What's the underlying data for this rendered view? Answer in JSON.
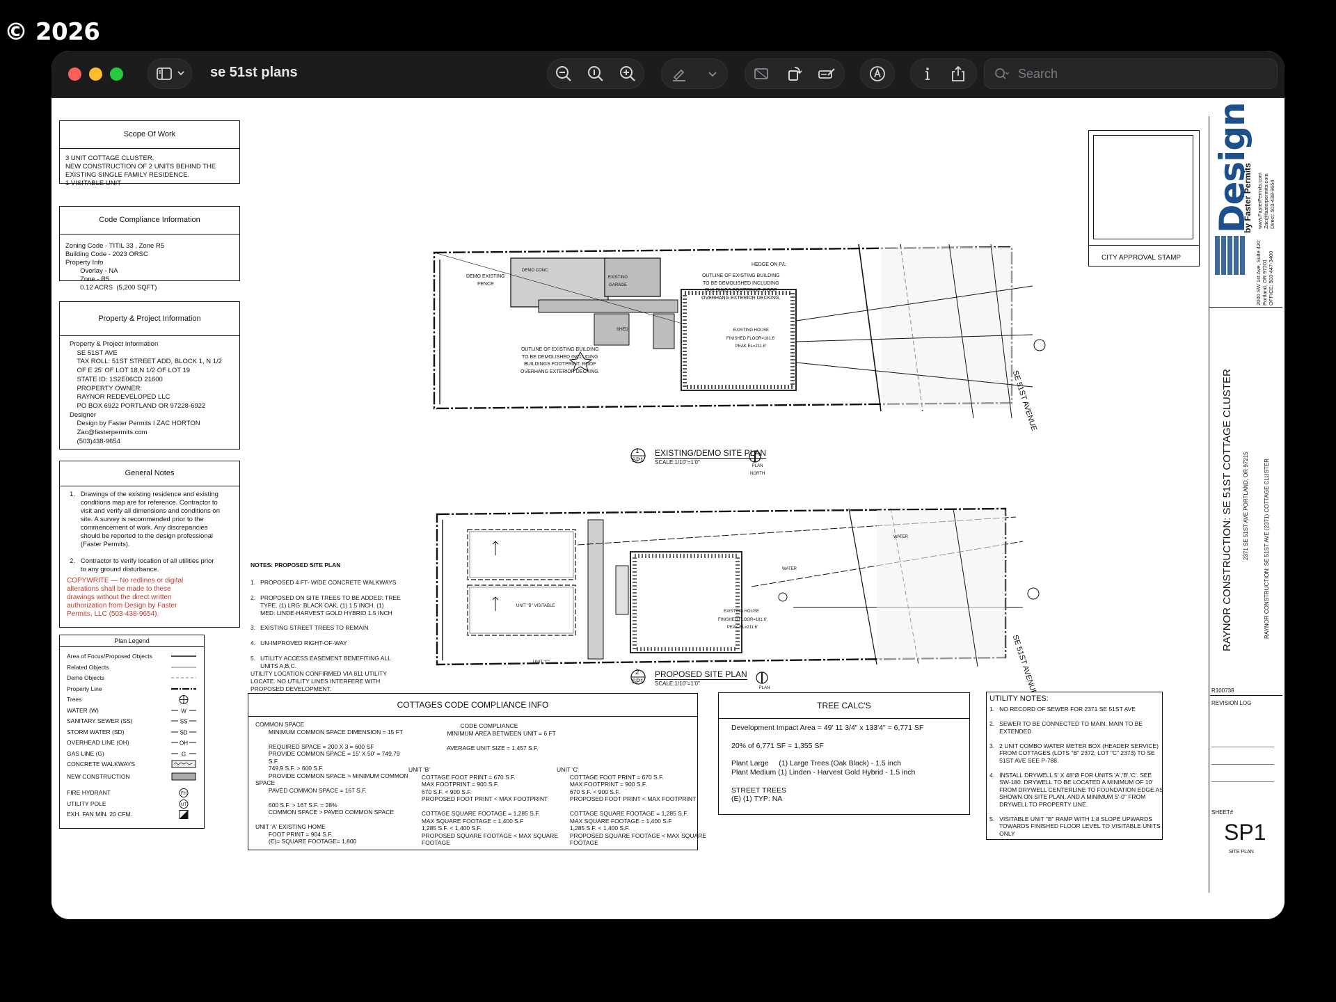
{
  "watermark": "© 2026",
  "window": {
    "title": "se 51st plans",
    "search_placeholder": "Search",
    "toolbar_icons": [
      "sidebar-icon",
      "chevron-down-icon",
      "zoom-out-icon",
      "actual-size-icon",
      "zoom-in-icon",
      "highlight-pen-icon",
      "chevron-down-icon",
      "crop-icon",
      "rotate-icon",
      "markup-sign-icon",
      "markup-circle-icon",
      "info-icon",
      "share-icon",
      "search-icon"
    ]
  },
  "sheet": {
    "scope": {
      "title": "Scope Of Work",
      "body": "3 UNIT COTTAGE CLUSTER.\nNEW CONSTRUCTION OF 2 UNITS BEHIND THE\nEXISTING SINGLE FAMILY RESIDENCE.\n1 VISITABLE UNIT"
    },
    "code": {
      "title": "Code Compliance Information",
      "body": "Zoning Code - TITIL 33 , Zone R5\nBuilding Code - 2023 ORSC\nProperty Info\n        Overlay - NA\n        Zone - R5\n        0.12 ACRS  (5,200 SQFT)"
    },
    "property": {
      "title": "Property & Project Information",
      "body": "Property & Project Information\n    SE 51ST AVE\n    TAX ROLL: 51ST STREET ADD, BLOCK 1, N 1/2\n    OF E 25' OF LOT 18,N 1/2 OF LOT 19\n    STATE ID: 1S2E06CD 21600\n    PROPERTY OWNER:\n    RAYNOR REDEVELOPED LLC\n    PO BOX 6922 PORTLAND OR 97228-6922\nDesigner\n    Design by Faster Permits I ZAC HORTON\n    Zac@fasterpermits.com\n    (503)438-9654"
    },
    "general": {
      "title": "General Notes",
      "body": "1.   Drawings of the existing residence and existing\n      conditions map are for reference. Contractor to\n      visit and verify all dimensions and conditions on\n      site. A survey is recommended prior to the\n      commencement of work. Any discrepancies\n      should be reported to the design professional\n      (Faster Permits).\n\n2.   Contractor to verify location of all utilities prior\n      to any ground disturbance.",
      "copyright": "COPYWRITE — No redlines or digital\nalterations shall be made to these\ndrawings without the direct written\nauthorization from Design by Faster\nPermits, LLC (503-438-9654)."
    },
    "legend": {
      "title": "Plan Legend",
      "items": [
        "Area of Focus/Proposed Objects",
        "Related Objects",
        "Demo Objects",
        "Property Line",
        "Trees",
        "WATER  (W)",
        "SANITARY SEWER (SS)",
        "STORM WATER (SD)",
        "OVERHEAD LINE (OH)",
        "GAS LINE (G)",
        "CONCRETE WALKWAYS",
        "NEW CONSTRUCTION",
        "FIRE HYDRANT",
        "UTILITY POLE",
        "EXH. FAN MIN. 20 CFM."
      ]
    },
    "notes_proposed": {
      "title": "NOTES: PROPOSED SITE PLAN",
      "body": "1.   PROPOSED 4 FT- WIDE CONCRETE WALKWAYS\n\n2.   PROPOSED ON SITE TREES TO BE ADDED: TREE\n      TYPE. (1) LRG: BLACK OAK, (1) 1.5 INCH. (1)\n      MED: LINDE-HARVEST GOLD HYBRID 1.5 INCH\n\n3.   EXISTING STREET TREES TO REMAIN\n\n4.   UN-IMPROVED RIGHT-OF-WAY\n\n5.   UTILITY ACCESS EASEMENT BENEFITING ALL\n      UNITS A,B,C.\nUTILITY LOCATION CONFIRMED VIA 811 UTILITY\nLOCATE. NO UTILITY LINES INTERFERE WITH\nPROPOSED DEVELOPMENT."
    },
    "plan1": {
      "num": "1",
      "sheet": "SP1",
      "title": "EXISTING/DEMO SITE PLAN",
      "scale": "SCALE:1/10\"=1'0\"",
      "north": "PLAN\nNORTH",
      "street": "SE 51ST AVENUE",
      "house": "EXISTING HOUSE",
      "floor": "FINISHED FLOOR=181.6'\nPEAK EL=211.6'",
      "demo_note1": "OUTLINE OF EXISTING BUILDING\nTO BE DEMOLISHED INCLUDING\nBUILDINGS FOOTPRINT, ROOF\nOVERHANG EXTERIOR DECKING.",
      "demo_note2": "OUTLINE OF EXISTING BUILDING\nTO BE DEMOLISHED INCLUDING\nBUILDINGS FOOTPRINT, ROOF\nOVERHANG EXTERIOR DECKING.",
      "fence": "DEMO EXISTING\nFENCE",
      "conc": "DEMO CONC.",
      "garage": "EXISTING\nGARAGE",
      "shed": "SHED",
      "hedge": "HEDGE ON P/L"
    },
    "plan2": {
      "num": "2",
      "sheet": "SP1",
      "title": "PROPOSED SITE PLAN",
      "scale": "SCALE:1/10\"=1'0\"",
      "north": "PLAN\nNORTH",
      "street": "SE 51ST AVENUE",
      "unitB": "UNIT \"B\" VISITABLE",
      "unitC": "UNIT \"C\"",
      "house": "EXISTING HOUSE",
      "floor": "FINISHED FLOOR=181.6'\nPEAK EL=211.6'",
      "water": "WATER"
    },
    "cottages": {
      "title": "COTTAGES CODE COMPLIANCE INFO",
      "col1": "COMMON SPACE\n        MINIMUM COMMON SPACE DIMENSION = 15 FT\n\n        REQUIRED SPACE = 200 X 3 = 600 SF\n        PROVIDE COMMON SPACE = 15' X 50' = 749.79\n        S.F.\n        749.9 S.F. > 600 S.F.\n        PROVIDE COMMON SPACE > MINIMUM COMMON\nSPACE\n        PAVED COMMON SPACE = 167 S.F.\n\n        600 S.F. > 167 S.F. = 28%\n        COMMON SPACE > PAVED COMMON SPACE\n\nUNIT 'A' EXISTING HOME\n        FOOT PRINT = 904 S.F.\n        (E)= SQUARE FOOTAGE= 1,800",
      "col2": "            CODE COMPLIANCE\n    MINIMUM AREA BETWEEN UNIT = 6 FT\n\n    AVERAGE UNIT SIZE = 1,457 S.F.",
      "unitB": "UNIT 'B'\n        COTTAGE FOOT PRINT = 670 S.F.\n        MAX FOOTPRINT = 900 S.F.\n        670 S.F. < 900 S.F.\n        PROPOSED FOOT PRINT < MAX FOOTPRINT\n\n        COTTAGE SQUARE FOOTAGE = 1,285 S.F.\n        MAX SQUARE FOOTAGE = 1,400 S.F\n        1,285 S.F. < 1,400 S.F.\n        PROPOSED SQUARE FOOTAGE < MAX SQUARE\n        FOOTAGE",
      "unitC": "UNIT 'C'\n        COTTAGE FOOT PRINT = 670 S.F.\n        MAX FOOTPRINT = 900 S.F.\n        670 S.F. < 900 S.F.\n        PROPOSED FOOT PRINT < MAX FOOTPRINT\n\n        COTTAGE SQUARE FOOTAGE = 1,285 S.F.\n        MAX SQUARE FOOTAGE = 1,400 S.F\n        1,285 S.F. < 1,400 S.F.\n        PROPOSED SQUARE FOOTAGE < MAX SQUARE\n        FOOTAGE"
    },
    "tree": {
      "title": "TREE CALC'S",
      "body": "Development Impact Area = 49' 11 3/4\" x 133'4\" = 6,771 SF\n\n20% of 6,771 SF = 1,355 SF\n\nPlant Large     (1) Large Trees (Oak Black) - 1.5 inch\nPlant Medium (1) Linden - Harvest Gold Hybrid - 1.5 inch\n\nSTREET TREES\n(E) (1) TYP: NA"
    },
    "utility": {
      "title": "UTILITY NOTES:",
      "body": "1.   NO RECORD OF SEWER FOR 2371 SE 51ST AVE\n\n2.   SEWER TO BE CONNECTED TO MAIN. MAIN TO BE\n      EXTENDED\n\n3.   2 UNIT COMBO WATER METER BOX (HEADER SERVICE)\n      FROM COTTAGES (LOTS \"B\" 2372, LOT \"C\" 2373) TO SE\n      51ST AVE SEE P-788.\n\n4.   INSTALL DRYWELL 5' X 48\"Ø FOR UNITS 'A','B','C'. SEE\n      SW-180. DRYWELL TO BE LOCATED A MINIMUM OF 10'\n      FROM DRYWELL CENTERLINE TO FOUNDATION EDGE AS\n      SHOWN ON SITE PLAN, AND A MINIMUM 5'-0\" FROM\n      DRYWELL TO PROPERTY LINE.\n\n5.   VISITABLE UNIT \"B\" RAMP WITH 1:8 SLOPE UPWARDS\n      TOWARDS FINISHED FLOOR LEVEL TO VISITABLE UNITS\n      ONLY"
    },
    "stamp": "CITY APPROVAL STAMP",
    "brand": {
      "word": "Design",
      "by": "by Faster Permits",
      "address": "2000 SW 1st Ave, Suite 420\nPortland, OR 97201\nOFFICE: 503-447-3400",
      "contact": "www.FasterPermits.com\nZac@fasterpermits.com\nDirect: 503-438-9654"
    },
    "project": {
      "title": "RAYNOR CONSTRUCTION: SE 51ST COTTAGE CLUSTER",
      "address": "2371 SE 51ST AVE PORTLAND, OR 97215",
      "sub": "RAYNOR CONSTRUCTION: SE 51ST AVE (2371) COTTAGE CLUSTER"
    },
    "revision": {
      "code": "R100738",
      "label": "REVISION LOG"
    },
    "sheet_label": "SHEET#",
    "sheet_num": "SP1",
    "sheet_name": "SITE PLAN"
  }
}
